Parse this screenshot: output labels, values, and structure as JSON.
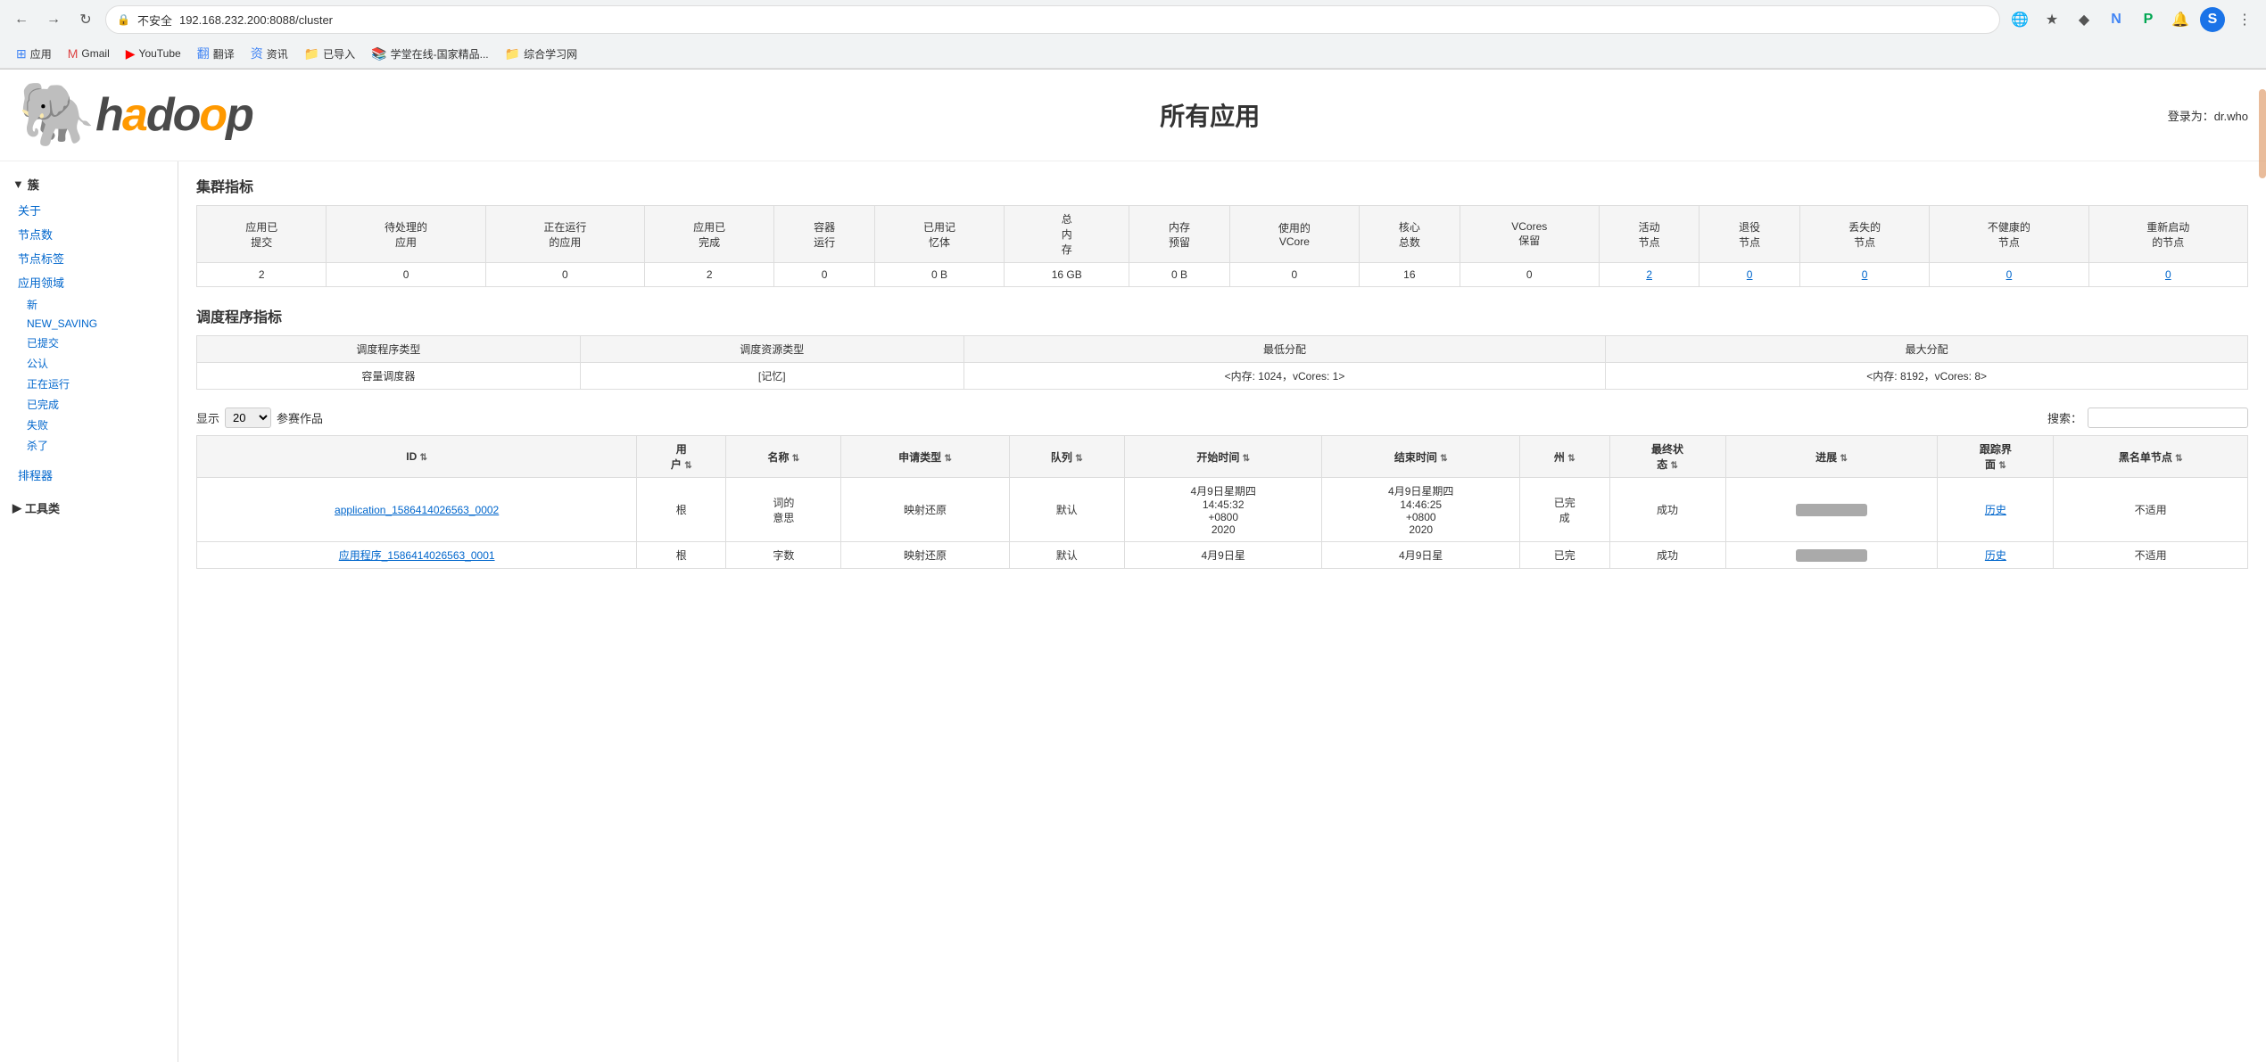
{
  "browser": {
    "url": "192.168.232.200:8088/cluster",
    "lock_label": "不安全",
    "nav_back": "←",
    "nav_forward": "→",
    "nav_refresh": "↻"
  },
  "bookmarks": [
    {
      "id": "apps",
      "icon": "⊞",
      "label": "应用",
      "color": "blue"
    },
    {
      "id": "gmail",
      "icon": "M",
      "label": "Gmail",
      "color": "red"
    },
    {
      "id": "youtube",
      "icon": "▶",
      "label": "YouTube",
      "color": "red"
    },
    {
      "id": "translate",
      "icon": "翻",
      "label": "翻译",
      "color": "blue"
    },
    {
      "id": "news",
      "icon": "资",
      "label": "资讯",
      "color": "blue"
    },
    {
      "id": "imported",
      "icon": "📁",
      "label": "已导入",
      "color": "yellow"
    },
    {
      "id": "study",
      "icon": "📚",
      "label": "学堂在线-国家精品...",
      "color": "blue"
    },
    {
      "id": "综合",
      "icon": "📁",
      "label": "综合学习网",
      "color": "yellow"
    }
  ],
  "header": {
    "logo_alt": "Hadoop elephant logo",
    "logo_text": "hadoop",
    "page_title": "所有应用",
    "user_label": "登录为：dr.who"
  },
  "sidebar": {
    "cluster_header": "▼ 簇",
    "cluster_links": [
      {
        "label": "关于",
        "indent": false
      },
      {
        "label": "节点数",
        "indent": false
      },
      {
        "label": "节点标签",
        "indent": false
      },
      {
        "label": "应用领域",
        "indent": false
      }
    ],
    "app_sub_links": [
      {
        "label": "新"
      },
      {
        "label": "NEW_SAVING"
      },
      {
        "label": "已提交"
      },
      {
        "label": "公认"
      },
      {
        "label": "正在运行"
      },
      {
        "label": "已完成"
      },
      {
        "label": "失败"
      },
      {
        "label": "杀了"
      }
    ],
    "scheduler_label": "排程器",
    "tools_header": "▶ 工具类"
  },
  "cluster_metrics": {
    "section_title": "集群指标",
    "headers": [
      "应用已提交",
      "待处理的应用",
      "正在运行的应用",
      "应用已完成",
      "容器运行",
      "已用记忆体",
      "总内存",
      "内存预留",
      "使用的VCore",
      "核心总数",
      "VCores保留",
      "活动节点",
      "退役节点",
      "丢失的节点",
      "不健康的节点",
      "重新启动的节点"
    ],
    "values": [
      "2",
      "0",
      "0",
      "2",
      "0",
      "0 B",
      "16 GB",
      "0 B",
      "0",
      "16",
      "0",
      "2",
      "0",
      "0",
      "0",
      "0"
    ],
    "link_indices": [
      11,
      12,
      13,
      14,
      15
    ]
  },
  "scheduler_metrics": {
    "section_title": "调度程序指标",
    "headers": [
      "调度程序类型",
      "调度资源类型",
      "最低分配",
      "最大分配"
    ],
    "values": [
      "容量调度器",
      "[记忆]",
      "<内存: 1024，vCores: 1>",
      "<内存: 8192，vCores: 8>"
    ]
  },
  "applications": {
    "show_label": "显示",
    "show_value": "20",
    "entries_label": "参考作品",
    "search_label": "搜索：",
    "search_placeholder": "",
    "columns": [
      {
        "key": "id",
        "label": "ID"
      },
      {
        "key": "user",
        "label": "用户"
      },
      {
        "key": "name",
        "label": "名称"
      },
      {
        "key": "app_type",
        "label": "申请类型"
      },
      {
        "key": "queue",
        "label": "队列"
      },
      {
        "key": "start_time",
        "label": "开始时间"
      },
      {
        "key": "end_time",
        "label": "结束时间"
      },
      {
        "key": "state",
        "label": "州"
      },
      {
        "key": "final_status",
        "label": "最终状态"
      },
      {
        "key": "progress",
        "label": "进展"
      },
      {
        "key": "tracking",
        "label": "跟踪界面"
      },
      {
        "key": "blacklist",
        "label": "黑名单节点"
      }
    ],
    "rows": [
      {
        "id": "application_1586414026563_0002",
        "id_link": true,
        "user": "根",
        "name": "词的意思",
        "app_type": "映射还原",
        "queue": "默认",
        "start_time": "4月9日星期四\n14:45:32\n+0800\n2020",
        "end_time": "4月9日星期四\n14:46:25\n+0800\n2020",
        "state": "已完成",
        "final_status": "成功",
        "progress": 100,
        "tracking": "历史",
        "blacklist": "不适用"
      },
      {
        "id": "应用程序_1586414026563_0001",
        "id_link": false,
        "user": "根",
        "name": "字数",
        "app_type": "映射还原",
        "queue": "默认",
        "start_time": "4月9日星",
        "end_time": "4月9日星",
        "state": "已完",
        "final_status": "成功",
        "progress": 100,
        "tracking": "历史",
        "blacklist": "不适用"
      }
    ]
  }
}
